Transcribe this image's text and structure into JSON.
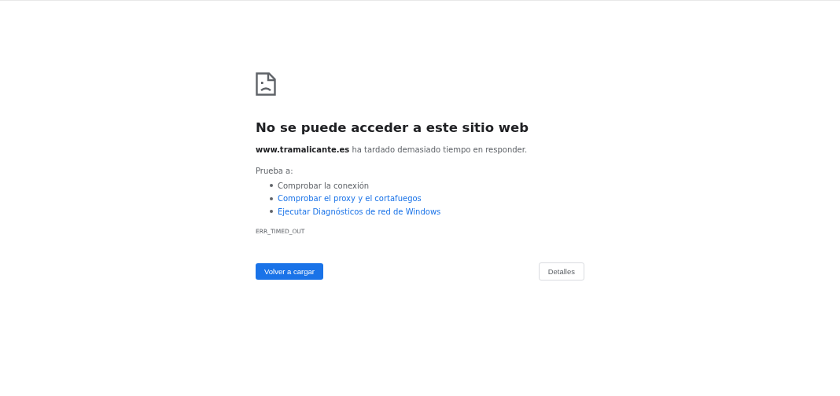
{
  "heading": "No se puede acceder a este sitio web",
  "summary": "**www.tramalicante.es** ha tardado demasiado tiempo en responder.",
  "suggestions_label": "Prueba a:",
  "suggestions": [
    {
      "kind": "text",
      "label": "Comprobar la conexión"
    },
    {
      "kind": "link",
      "label": "Comprobar el proxy y el cortafuegos"
    },
    {
      "kind": "link",
      "label": "Ejecutar Diagnósticos de red de Windows"
    }
  ],
  "error_code": "ERR_TIMED_OUT",
  "buttons": [
    {
      "kind": "primary",
      "label": "Volver a cargar"
    },
    {
      "kind": "secondary",
      "label": "Detalles"
    }
  ]
}
